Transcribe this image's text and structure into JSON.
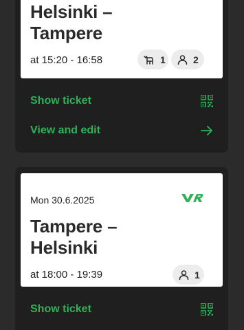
{
  "trips": [
    {
      "route_line1": "Helsinki –",
      "route_line2": "Tampere",
      "time": "at 15:20 - 16:58",
      "pets_count": "1",
      "passengers_count": "2",
      "show_ticket_label": "Show ticket",
      "view_edit_label": "View and edit"
    },
    {
      "date": "Mon 30.6.2025",
      "route_line1": "Tampere –",
      "route_line2": "Helsinki",
      "time": "at 18:00 - 19:39",
      "passengers_count": "1",
      "show_ticket_label": "Show ticket"
    }
  ],
  "icons": {
    "brand_logo": "vr-logo",
    "pet": "dog-icon",
    "passenger": "person-icon",
    "qr": "qr-code-icon",
    "arrow": "arrow-right-icon"
  },
  "colors": {
    "background": "#2b2b2b",
    "card": "#1f1f1f",
    "accent_green": "#2fb157",
    "ticket_bg": "#ffffff"
  }
}
